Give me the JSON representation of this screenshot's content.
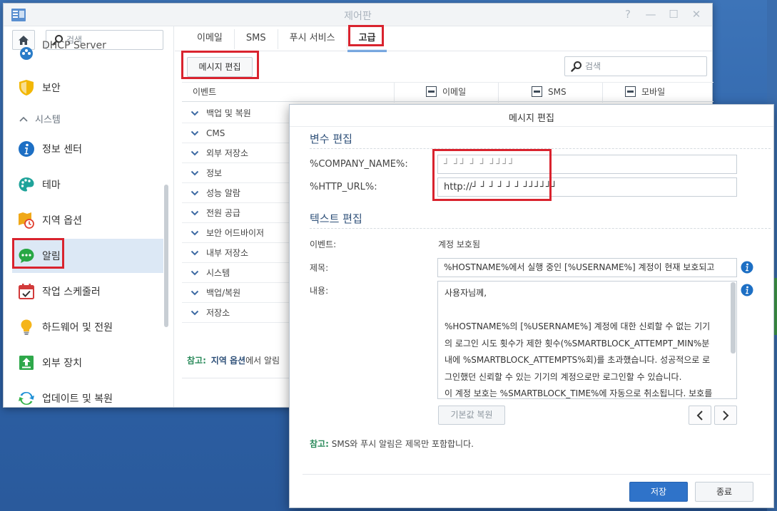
{
  "window": {
    "title": "제어판",
    "controls": {
      "help": "?",
      "minimize": "—",
      "maximize": "☐",
      "close": "✕"
    }
  },
  "sidebar": {
    "search_placeholder": "검색",
    "items": [
      {
        "label": "DHCP Server",
        "icon": "dhcp-server-icon"
      },
      {
        "label": "보안",
        "icon": "shield-icon"
      },
      {
        "label": "정보 센터",
        "icon": "info-center-icon"
      },
      {
        "label": "테마",
        "icon": "palette-icon"
      },
      {
        "label": "지역 옵션",
        "icon": "regional-options-icon"
      },
      {
        "label": "알림",
        "icon": "notification-icon"
      },
      {
        "label": "작업 스케줄러",
        "icon": "task-scheduler-icon"
      },
      {
        "label": "하드웨어 및 전원",
        "icon": "lightbulb-icon"
      },
      {
        "label": "외부 장치",
        "icon": "external-device-icon"
      },
      {
        "label": "업데이트 및 복원",
        "icon": "update-restore-icon"
      }
    ],
    "section_system": "시스템"
  },
  "main": {
    "tabs": [
      {
        "label": "이메일"
      },
      {
        "label": "SMS"
      },
      {
        "label": "푸시 서비스"
      },
      {
        "label": "고급"
      }
    ],
    "edit_message_button": "메시지 편집",
    "search_placeholder": "검색",
    "columns": {
      "event": "이벤트",
      "email": "이메일",
      "sms": "SMS",
      "mobile": "모바일"
    },
    "categories": [
      "백업 및 복원",
      "CMS",
      "외부 저장소",
      "정보",
      "성능 알람",
      "전원 공급",
      "보안 어드바이저",
      "내부 저장소",
      "시스템",
      "백업/복원",
      "저장소"
    ],
    "note": {
      "prefix": "참고:",
      "bold": "지역 옵션",
      "rest": "에서 알림"
    }
  },
  "dialog": {
    "title": "메시지 편집",
    "variable_section": "변수 편집",
    "company_name_label": "%COMPANY_NAME%:",
    "company_name_value": "┘ ┘┘ ┘ ┘ ┘┘┘┘",
    "http_url_label": "%HTTP_URL%:",
    "http_url_value": "http://┘ ┘ ┘ ┘ ┘ ┘ ┘┘┘┘┘┘",
    "text_section": "텍스트 편집",
    "event_label": "이벤트:",
    "event_value": "계정 보호됨",
    "subject_label": "제목:",
    "subject_value": "%HOSTNAME%에서 실행 중인 [%USERNAME%] 계정이 현재 보호되고",
    "content_label": "내용:",
    "content_lines": [
      "사용자님께,",
      "",
      "%HOSTNAME%의 [%USERNAME%] 계정에 대한 신뢰할 수 없는 기기",
      "의 로그인 시도 횟수가 제한 횟수(%SMARTBLOCK_ATTEMPT_MIN%분",
      "내에 %SMARTBLOCK_ATTEMPTS%회)를 초과했습니다. 성공적으로 로",
      "그인했던 신뢰할 수 있는 기기의 계정으로만 로그인할 수 있습니다.",
      "이 계정 보호는 %SMARTBLOCK_TIME%에 자동으로 취소됩니다. 보호를"
    ],
    "reset_button": "기본값 복원",
    "note": {
      "prefix": "참고:",
      "text": "SMS와 푸시 알림은 제목만 포함합니다."
    },
    "save_button": "저장",
    "close_button": "종료"
  },
  "colors": {
    "accent": "#2f73c9",
    "highlight_red": "#d9232e",
    "section_title": "#2d4f78",
    "note_green": "#2a8a5a"
  }
}
